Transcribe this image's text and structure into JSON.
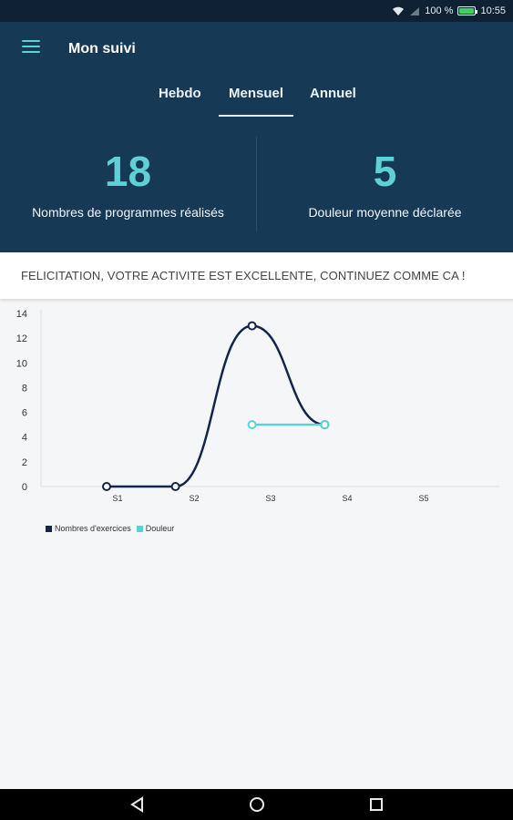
{
  "status_bar": {
    "battery": "100 %",
    "time": "10:55",
    "icons": [
      "wifi-icon",
      "signal-icon",
      "battery-icon"
    ]
  },
  "header": {
    "title": "Mon suivi",
    "menu_icon": "menu-icon"
  },
  "tabs": [
    {
      "label": "Hebdo",
      "active": false
    },
    {
      "label": "Mensuel",
      "active": true
    },
    {
      "label": "Annuel",
      "active": false
    }
  ],
  "stats": [
    {
      "value": "18",
      "label": "Nombres de programmes réalisés"
    },
    {
      "value": "5",
      "label": "Douleur moyenne déclarée"
    }
  ],
  "banner": {
    "message": "FELICITATION, VOTRE ACTIVITE EST EXCELLENTE, CONTINUEZ COMME CA !"
  },
  "colors": {
    "header_bg": "#163a56",
    "accent": "#5fd0d8",
    "series_exercices": "#13254a",
    "series_douleur": "#5fd0d8"
  },
  "chart_data": {
    "type": "line",
    "categories": [
      "S1",
      "S2",
      "S3",
      "S4",
      "S5"
    ],
    "yticks": [
      "0",
      "2",
      "4",
      "6",
      "8",
      "10",
      "12",
      "14"
    ],
    "ylim": [
      0,
      14
    ],
    "series": [
      {
        "name": "Nombres d'exercices",
        "points": [
          [
            0.0,
            0
          ],
          [
            0.9,
            0
          ],
          [
            1.9,
            13
          ],
          [
            2.85,
            5
          ]
        ]
      },
      {
        "name": "Douleur",
        "points": [
          [
            1.9,
            5
          ],
          [
            2.85,
            5
          ]
        ]
      }
    ],
    "legend_position": "bottom-left"
  },
  "nav": {
    "back": "back-icon",
    "home": "home-icon",
    "recents": "recents-icon"
  }
}
